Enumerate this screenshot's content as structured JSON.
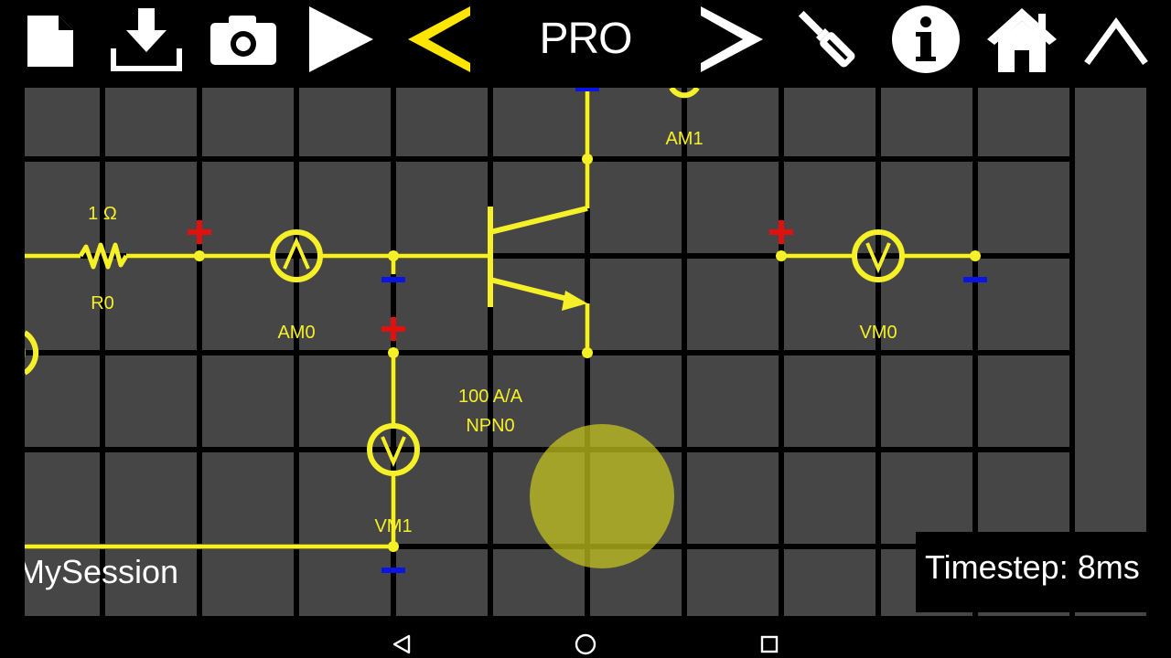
{
  "toolbar": {
    "title": "PRO",
    "buttons": [
      {
        "name": "new-file-button",
        "icon": "file-icon"
      },
      {
        "name": "download-button",
        "icon": "download-icon"
      },
      {
        "name": "screenshot-button",
        "icon": "camera-icon"
      },
      {
        "name": "play-button",
        "icon": "play-icon"
      },
      {
        "name": "previous-button",
        "icon": "chevron-left-icon"
      },
      {
        "name": "next-button",
        "icon": "chevron-right-icon"
      },
      {
        "name": "tools-button",
        "icon": "screwdriver-icon"
      },
      {
        "name": "info-button",
        "icon": "info-icon"
      },
      {
        "name": "home-button",
        "icon": "home-icon"
      },
      {
        "name": "collapse-button",
        "icon": "chevron-up-icon"
      }
    ]
  },
  "circuit": {
    "components": {
      "resistor_value": "1 Ω",
      "resistor_name": "R0",
      "ammeter0_name": "AM0",
      "ammeter0_symbol": "A",
      "ammeter1_name": "AM1",
      "transistor_gain": "100 A/A",
      "transistor_name": "NPN0",
      "voltmeter0_name": "VM0",
      "voltmeter0_symbol": "V",
      "voltmeter1_name": "VM1",
      "voltmeter1_symbol": "V"
    },
    "colors": {
      "grid_background": "#464646",
      "grid_lines": "#000000",
      "wire": "#f5f028",
      "positive_terminal": "#e01010",
      "negative_terminal": "#0a14e6",
      "touch_indicator": "#b4b41e"
    }
  },
  "status": {
    "session_name": "MySession",
    "timestep": "Timestep: 8ms"
  },
  "navbar": {
    "buttons": [
      {
        "name": "nav-back-button",
        "icon": "triangle-back-icon"
      },
      {
        "name": "nav-home-button",
        "icon": "circle-home-icon"
      },
      {
        "name": "nav-recents-button",
        "icon": "square-recents-icon"
      }
    ]
  }
}
